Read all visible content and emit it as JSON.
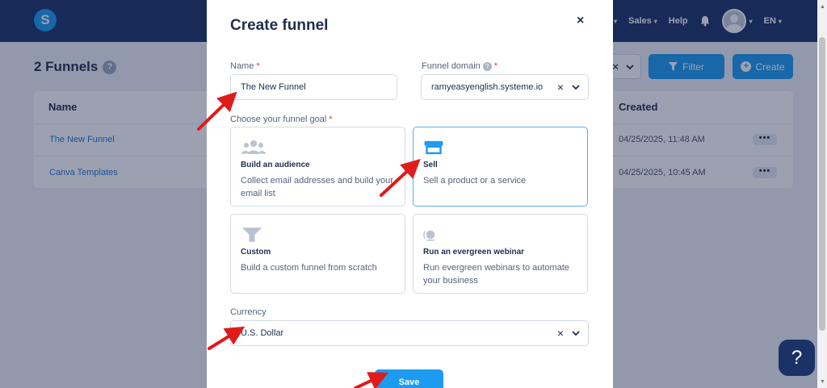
{
  "app": {
    "nav": {
      "sales": "Sales",
      "help": "Help",
      "language": "EN"
    },
    "page_title": "2 Funnels",
    "help_icon": "?",
    "filter_label": "Filter",
    "create_label": "Create",
    "table": {
      "headers": {
        "name": "Name",
        "created": "Created"
      },
      "rows": [
        {
          "name": "The New Funnel",
          "created": "04/25/2025, 11:48 AM",
          "more": "•••"
        },
        {
          "name": "Canva Templates",
          "created": "04/25/2025, 10:45 AM",
          "more": "•••"
        }
      ]
    },
    "chat_icon": "?"
  },
  "modal": {
    "title": "Create funnel",
    "close": "×",
    "name": {
      "label": "Name",
      "required": "*",
      "value": "The New Funnel"
    },
    "domain": {
      "label": "Funnel domain",
      "info": "?",
      "required": "*",
      "value": "ramyeasyenglish.systeme.io",
      "clear": "×"
    },
    "goal": {
      "label": "Choose your funnel goal",
      "required": "*",
      "options": [
        {
          "title": "Build an audience",
          "desc": "Collect email addresses and build your email list",
          "icon": "users-icon"
        },
        {
          "title": "Sell",
          "desc": "Sell a product or a service",
          "icon": "store-icon"
        },
        {
          "title": "Custom",
          "desc": "Build a custom funnel from scratch",
          "icon": "funnel-icon"
        },
        {
          "title": "Run an evergreen webinar",
          "desc": "Run evergreen webinars to automate your business",
          "icon": "webinar-icon"
        }
      ],
      "selected": "Sell"
    },
    "currency": {
      "label": "Currency",
      "value": "U.S. Dollar",
      "clear": "×"
    },
    "save_label": "Save"
  },
  "colors": {
    "brand": "#1a3266",
    "accent": "#1d9bf0",
    "required": "#e0364c",
    "annotation_arrow": "#e01b1b"
  }
}
